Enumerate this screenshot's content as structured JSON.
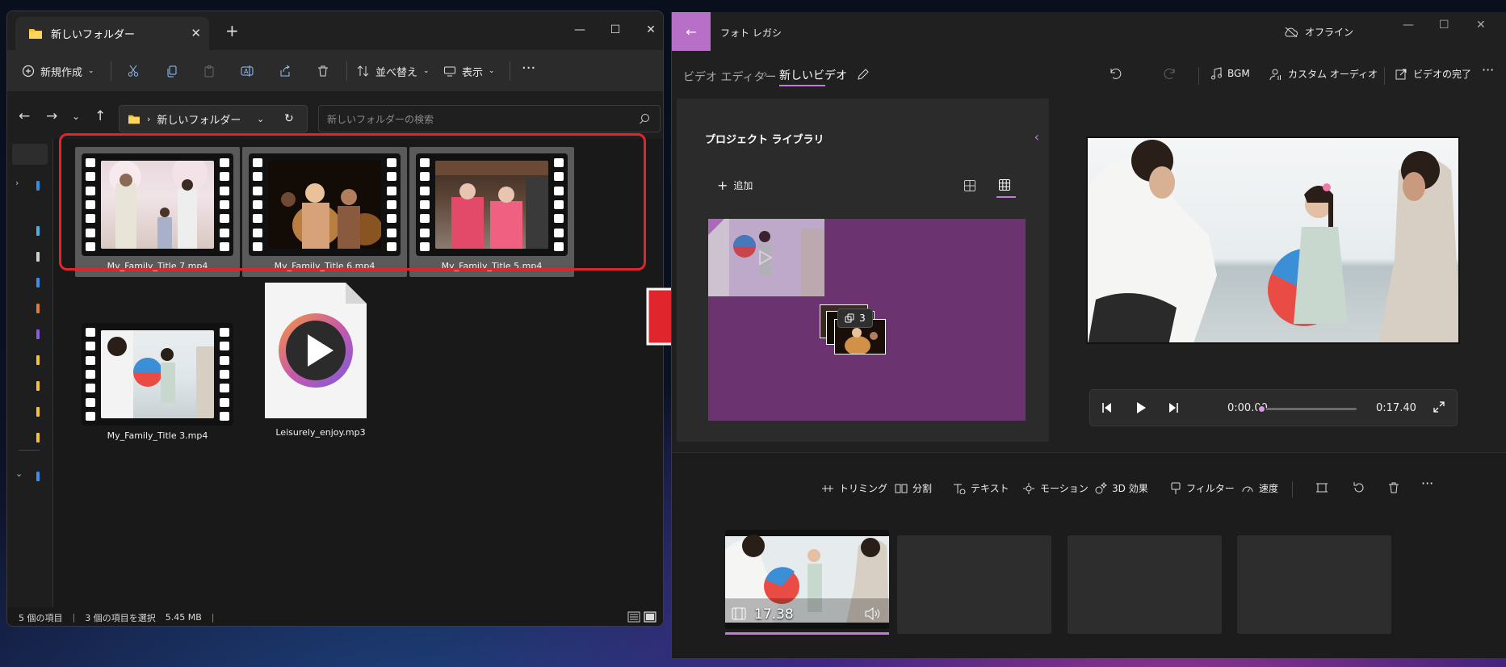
{
  "explorer": {
    "tab_title": "新しいフォルダー",
    "toolbar": {
      "new": "新規作成",
      "sort": "並べ替え",
      "view": "表示"
    },
    "breadcrumb": "新しいフォルダー",
    "search_placeholder": "新しいフォルダーの検索",
    "files": [
      {
        "name": "My_Family_Title 7.mp4",
        "selected": true
      },
      {
        "name": "My_Family_Title 6.mp4",
        "selected": true
      },
      {
        "name": "My_Family_Title 5.mp4",
        "selected": true
      },
      {
        "name": "My_Family_Title 3.mp4",
        "selected": false
      },
      {
        "name": "Leisurely_enjoy.mp3",
        "selected": false
      }
    ],
    "status": {
      "count": "5 個の項目",
      "selected": "3 個の項目を選択",
      "size": "5.45 MB"
    }
  },
  "photos": {
    "app_title": "フォト レガシ",
    "offline": "オフライン",
    "breadcrumb_parent": "ビデオ エディター",
    "breadcrumb_current": "新しいビデオ",
    "header": {
      "bgm": "BGM",
      "custom_audio": "カスタム オーディオ",
      "finish": "ビデオの完了"
    },
    "library": {
      "title": "プロジェクト ライブラリ",
      "add": "追加",
      "drag_count": "3"
    },
    "player": {
      "current": "0:00.00",
      "total": "0:17.40",
      "progress": 0
    },
    "storyboard_tools": {
      "trim": "トリミング",
      "split": "分割",
      "text": "テキスト",
      "motion": "モーション",
      "effects3d": "3D 効果",
      "filter": "フィルター",
      "speed": "速度"
    },
    "clip": {
      "duration": "17.38"
    },
    "accent": "#c27bd6"
  },
  "annotation": {
    "selection_color": "#e0262c",
    "arrow_color": "#e0262c"
  }
}
